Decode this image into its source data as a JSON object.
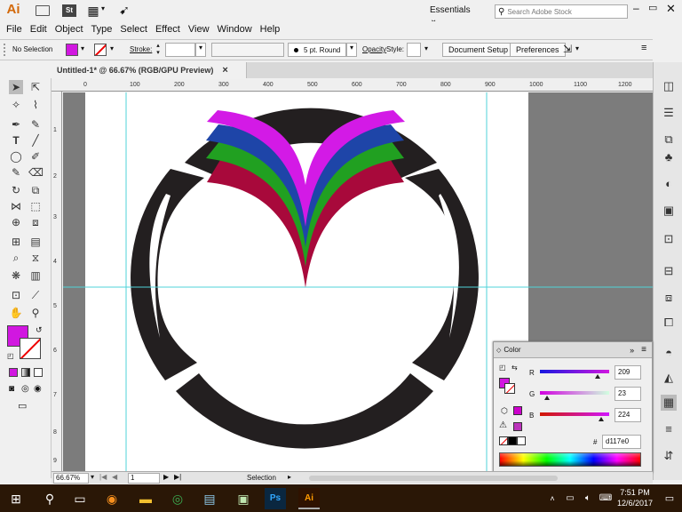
{
  "app": {
    "logo": "Ai",
    "workspace": "Essentials",
    "search_placeholder": "Search Adobe Stock",
    "stock_logo": "St"
  },
  "menu": [
    "File",
    "Edit",
    "Object",
    "Type",
    "Select",
    "Effect",
    "View",
    "Window",
    "Help"
  ],
  "control": {
    "selection_label": "No Selection",
    "stroke_label": "Stroke:",
    "brush": "5 pt. Round",
    "opacity_label": "Opacity",
    "style_label": "Style:",
    "document_setup": "Document Setup",
    "preferences": "Preferences"
  },
  "document": {
    "tab": "Untitled-1* @ 66.67% (RGB/GPU Preview)",
    "close": "×"
  },
  "ruler": {
    "h": [
      "0",
      "100",
      "200",
      "300",
      "400",
      "500",
      "600",
      "700",
      "800",
      "900",
      "1000",
      "1100",
      "1200"
    ],
    "v": [
      "1",
      "2",
      "3",
      "4",
      "5",
      "6",
      "7",
      "8",
      "9"
    ]
  },
  "status": {
    "zoom": "66.67%",
    "artboard": "1",
    "mode": "Selection"
  },
  "color_panel": {
    "title": "Color",
    "r_label": "R",
    "g_label": "G",
    "b_label": "B",
    "r": "209",
    "g": "23",
    "b": "224",
    "hex_label": "#",
    "hex": "d117e0"
  },
  "colors": {
    "fill": "#d117e0",
    "magenta": "#d31ae6",
    "blue": "#1e45a8",
    "green": "#21a021",
    "crimson": "#a8093b",
    "ring": "#231f20",
    "guide": "#4fd3d9"
  },
  "clock": {
    "time": "7:51 PM",
    "date": "12/6/2017"
  }
}
